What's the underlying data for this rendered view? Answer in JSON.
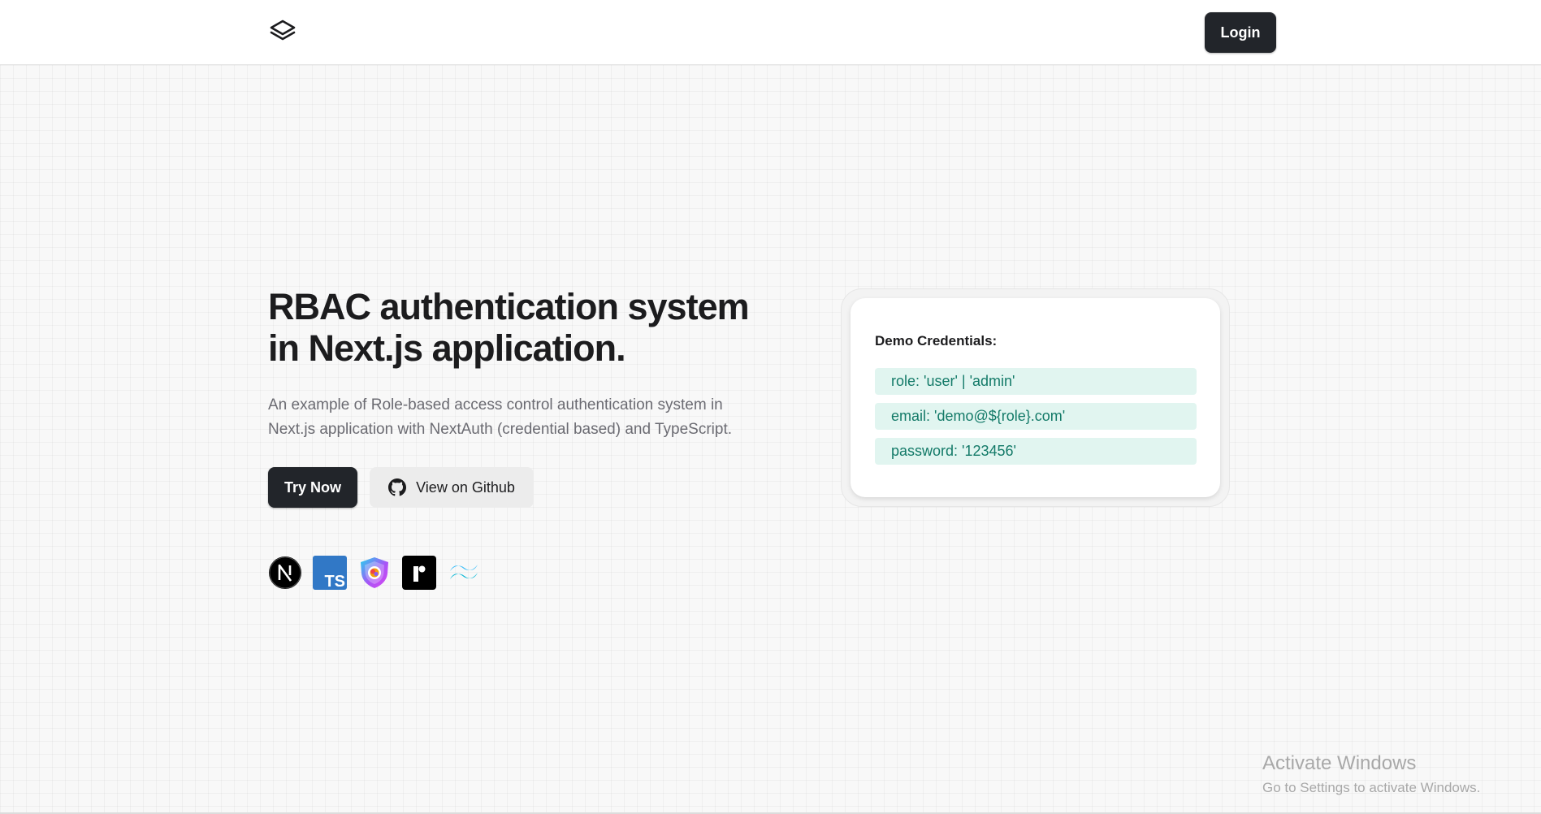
{
  "header": {
    "logo_icon": "layers-icon",
    "login_label": "Login"
  },
  "hero": {
    "title_line1": "RBAC authentication system",
    "title_line2": "in Next.js application.",
    "description_line1": "An example of Role-based access control authentication system in",
    "description_line2": "Next.js application with NextAuth (credential based) and TypeScript.",
    "try_label": "Try Now",
    "github_label": "View on Github",
    "github_icon": "github-icon"
  },
  "tech_stack": [
    {
      "icon": "nextjs-icon",
      "color": "#000000"
    },
    {
      "icon": "typescript-icon",
      "color": "#3178c6"
    },
    {
      "icon": "nextauth-shield-icon",
      "color": "#7e3ff2"
    },
    {
      "icon": "prisma-icon",
      "color": "#000000"
    },
    {
      "icon": "tailwind-icon",
      "color": "#38bdf8"
    }
  ],
  "credentials": {
    "title": "Demo Credentials:",
    "rows": [
      "role: 'user' | 'admin'",
      "email: 'demo@${role}.com'",
      "password: '123456'"
    ],
    "row_bg": "#e1f5f0",
    "row_text": "#137a68"
  },
  "watermark": {
    "title": "Activate Windows",
    "subtitle": "Go to Settings to activate Windows."
  }
}
